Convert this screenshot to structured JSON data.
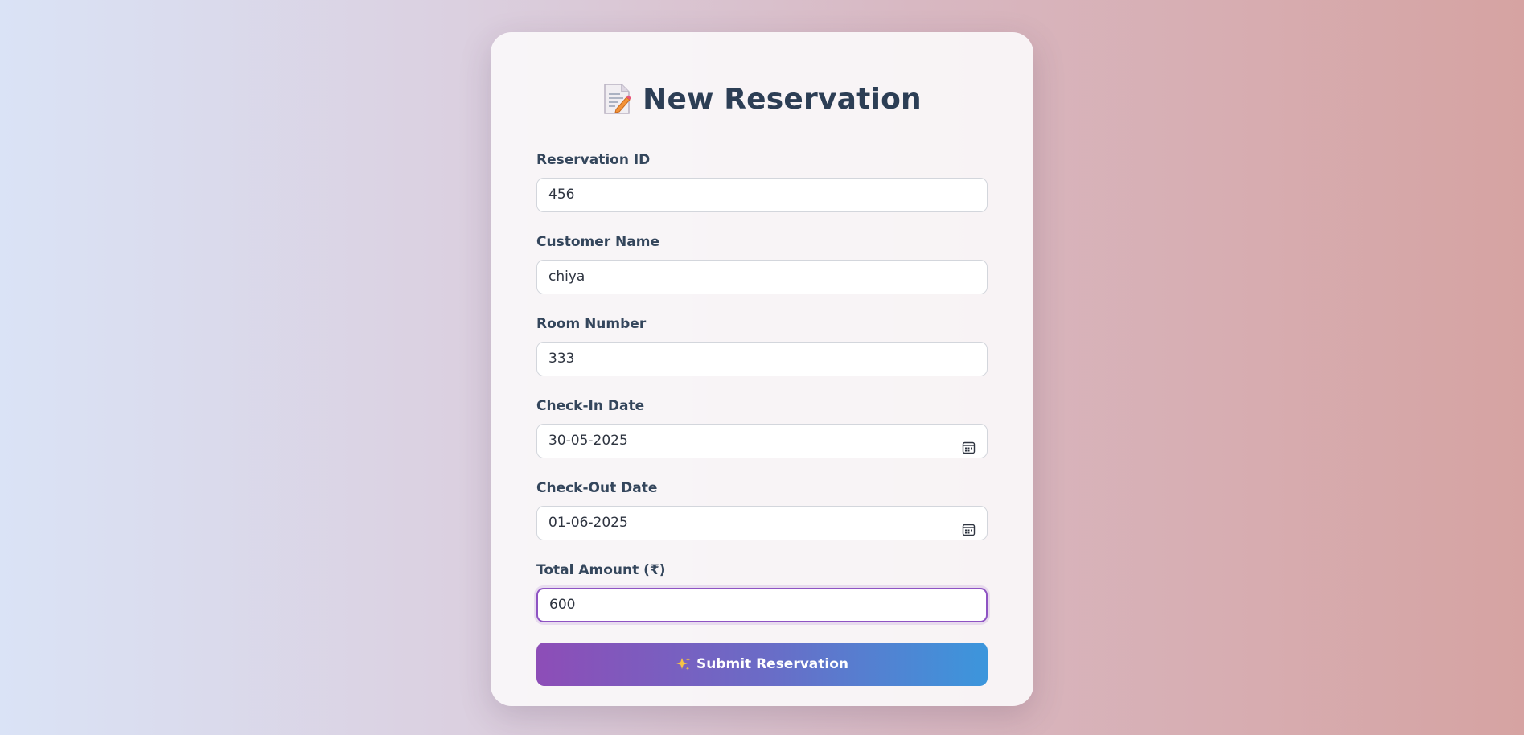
{
  "form": {
    "title": "New Reservation",
    "title_icon": "memo-icon",
    "fields": [
      {
        "label": "Reservation ID",
        "value": "456"
      },
      {
        "label": "Customer Name",
        "value": "chiya"
      },
      {
        "label": "Room Number",
        "value": "333"
      },
      {
        "label": "Check-In Date",
        "value": "30-05-2025",
        "icon": "calendar-icon"
      },
      {
        "label": "Check-Out Date",
        "value": "01-06-2025",
        "icon": "calendar-icon"
      },
      {
        "label": "Total Amount (₹)",
        "value": "600",
        "focused": true
      }
    ],
    "submit_label": "Submit Reservation",
    "submit_icon": "sparkles-icon"
  },
  "colors": {
    "title": "#2c3e55",
    "focus_border": "#8e53c3",
    "button_gradient_start": "#8d4db7",
    "button_gradient_end": "#3c96dc"
  }
}
